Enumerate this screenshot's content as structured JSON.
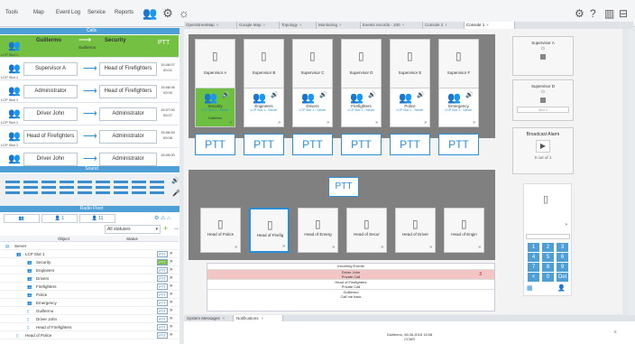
{
  "menu": [
    "Tools",
    "Map",
    "Event Log",
    "Service",
    "Reports"
  ],
  "tabs": [
    "OpenStreetMap",
    "Google Map",
    "Topology",
    "Monitoring",
    "Events records - 100",
    "Console 2",
    "Console 1"
  ],
  "calls": {
    "title": "Calls",
    "rows": [
      {
        "from": "Guillermo",
        "to": "Security",
        "sub": "Guillermo",
        "ptt": "PTT",
        "label": "LCP Slot 1",
        "time": ""
      },
      {
        "from": "Supervisor A",
        "to": "Head of Firefighters",
        "label": "LCP Slot 1",
        "time": "15:08:07 00:01"
      },
      {
        "from": "Administrator",
        "to": "Head of Firefighters",
        "label": "LCP Slot 1",
        "time": "15:08:06 00:00"
      },
      {
        "from": "Driver John",
        "to": "Administrator",
        "label": "LCP Slot 1",
        "time": "15:07:00 00:07"
      },
      {
        "from": "Head of Firefighters",
        "to": "Administrator",
        "label": "LCP Slot 1",
        "time": "15:06:53 00:06"
      },
      {
        "from": "Driver John",
        "to": "Administrator",
        "label": "",
        "time": "15:05:00"
      }
    ]
  },
  "sound": {
    "title": "Sound"
  },
  "radio": {
    "title": "Radio Fleet",
    "counts": [
      "1",
      "11"
    ],
    "filter": "All statuses",
    "col_object": "Object",
    "col_status": "Status",
    "tree": [
      {
        "name": "Server",
        "lvl": 0
      },
      {
        "name": "LCP Slot 1",
        "lvl": 1
      },
      {
        "name": "Security",
        "lvl": 2,
        "green": true
      },
      {
        "name": "Engineers",
        "lvl": 2
      },
      {
        "name": "Drivers",
        "lvl": 2
      },
      {
        "name": "Firefighters",
        "lvl": 2
      },
      {
        "name": "Police",
        "lvl": 2
      },
      {
        "name": "Emergency",
        "lvl": 2
      },
      {
        "name": "Guillermo",
        "lvl": 2
      },
      {
        "name": "Driver John",
        "lvl": 2
      },
      {
        "name": "Head of Firefighters",
        "lvl": 2
      },
      {
        "name": "Head of Police",
        "lvl": 1
      }
    ],
    "ptt": "PTT"
  },
  "supervisors": [
    "Supervisor A",
    "Supervisor B",
    "Supervisor C",
    "Supervisor D",
    "Supervisor E",
    "Supervisor F"
  ],
  "groups": [
    {
      "name": "Security",
      "slot": "LCP Slot 1 - Server",
      "status": "Guillermo"
    },
    {
      "name": "Engineers",
      "slot": "LCP Slot 1 - Server",
      "status": ""
    },
    {
      "name": "Drivers",
      "slot": "LCP Slot 1 - Server",
      "status": ""
    },
    {
      "name": "Firefighters",
      "slot": "LCP Slot 1 - Server",
      "status": ""
    },
    {
      "name": "Police",
      "slot": "LCP Slot 1 - Server",
      "status": ""
    },
    {
      "name": "Emergency",
      "slot": "LCP Slot 1 - Server",
      "status": ""
    }
  ],
  "ptt_label": "PTT",
  "side": {
    "sup_a": "Supervisor A",
    "sup_d": "Supervisor D",
    "slot": "Slot 1",
    "alarm_title": "Broadcast Alarm",
    "alarm_count": "0 out of 1"
  },
  "bottom_users": [
    "Head of Police",
    "Head of Firefig",
    "Head of Emerg",
    "Head of Secur",
    "Head of Driver",
    "Head of Engin"
  ],
  "events": {
    "title": "Incoming Events",
    "rows": [
      {
        "l1": "Driver John",
        "l2": "Private Call",
        "badge": "3",
        "hl": true
      },
      {
        "l1": "Head of Firefighters",
        "l2": "Private Call",
        "badge": "",
        "hl": false
      },
      {
        "l1": "Guillermo",
        "l2": "Call me back",
        "badge": "",
        "hl": false
      }
    ]
  },
  "keypad": [
    "1",
    "2",
    "3",
    "4",
    "5",
    "6",
    "7",
    "8",
    "9",
    "<",
    "0",
    "Del"
  ],
  "bottom_tabs": [
    "System Messages",
    "Notifications"
  ],
  "notification": {
    "line1": "Guillermo, 06.06.2018 15:08",
    "line2": "CCMS"
  },
  "colors": {
    "accent": "#4d9fd6",
    "green": "#74c043",
    "dark": "#808080"
  }
}
